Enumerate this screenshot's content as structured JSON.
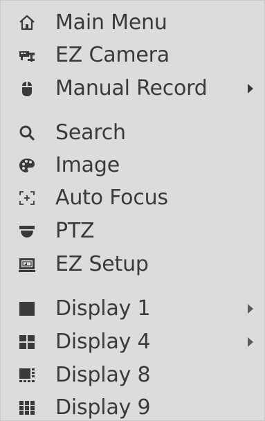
{
  "menu": {
    "items": [
      {
        "label": "Main Menu",
        "icon": "home-icon",
        "submenu": false
      },
      {
        "label": "EZ Camera",
        "icon": "camera-icon",
        "submenu": false
      },
      {
        "label": "Manual Record",
        "icon": "mouse-icon",
        "submenu": true
      },
      {
        "label": "Search",
        "icon": "search-icon",
        "submenu": false
      },
      {
        "label": "Image",
        "icon": "palette-icon",
        "submenu": false
      },
      {
        "label": "Auto Focus",
        "icon": "focus-icon",
        "submenu": false
      },
      {
        "label": "PTZ",
        "icon": "ptz-dome-icon",
        "submenu": false
      },
      {
        "label": "EZ Setup",
        "icon": "monitor-icon",
        "submenu": false
      },
      {
        "label": "Display 1",
        "icon": "display-1-icon",
        "submenu": true
      },
      {
        "label": "Display 4",
        "icon": "display-4-icon",
        "submenu": true
      },
      {
        "label": "Display 8",
        "icon": "display-8-icon",
        "submenu": false
      },
      {
        "label": "Display 9",
        "icon": "display-9-icon",
        "submenu": false
      }
    ]
  },
  "colors": {
    "menu_background": "#dcdcdc",
    "text": "#3a3a3a",
    "icon": "#3a3a3a"
  }
}
